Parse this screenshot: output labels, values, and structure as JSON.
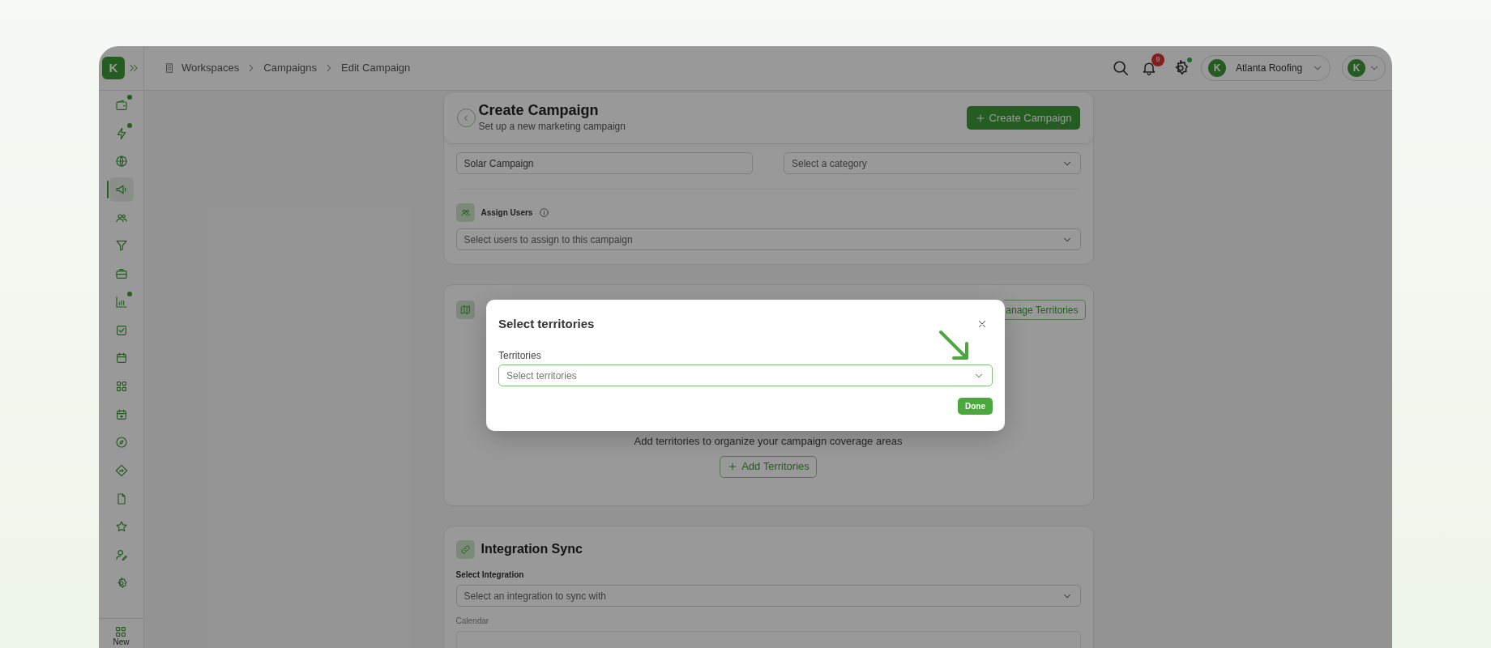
{
  "header": {
    "logo_text": "K",
    "notification_count": "9",
    "settings_dot": true,
    "organization": "Atlanta Roofing",
    "organization_logo": "K",
    "avatar": "K"
  },
  "breadcrumb": [
    {
      "label": "Workspaces"
    },
    {
      "label": "Campaigns"
    },
    {
      "label": "Edit Campaign"
    }
  ],
  "sidebar": {
    "items": [
      {
        "selected": false,
        "dot": true
      },
      {
        "selected": false,
        "dot": true
      },
      {
        "selected": false,
        "dot": false
      },
      {
        "selected": true,
        "dot": false
      },
      {
        "selected": false,
        "dot": false
      },
      {
        "selected": false,
        "dot": false
      },
      {
        "selected": false,
        "dot": false
      },
      {
        "selected": false,
        "dot": true
      },
      {
        "selected": false,
        "dot": false
      },
      {
        "selected": false,
        "dot": false
      },
      {
        "selected": false,
        "dot": false
      },
      {
        "selected": false,
        "dot": false
      },
      {
        "selected": false,
        "dot": false
      },
      {
        "selected": false,
        "dot": false
      },
      {
        "selected": false,
        "dot": false
      },
      {
        "selected": false,
        "dot": false
      },
      {
        "selected": false,
        "dot": false
      },
      {
        "selected": false,
        "dot": false
      }
    ],
    "new_label": "New"
  },
  "page": {
    "title": "Create Campaign",
    "subtitle": "Set up a new marketing campaign",
    "create_button": "Create Campaign"
  },
  "details": {
    "campaign_name_value": "Solar Campaign",
    "category_placeholder": "Select a category",
    "assign_users_label": "Assign Users",
    "users_placeholder": "Select users to assign to this campaign"
  },
  "territories": {
    "manage_button": "anage Territories",
    "empty_text": "Add territories to organize your campaign coverage areas",
    "add_button": "Add Territories"
  },
  "integration": {
    "title": "Integration Sync",
    "select_label": "Select Integration",
    "select_placeholder": "Select an integration to sync with",
    "calendar_label": "Calendar"
  },
  "modal": {
    "title": "Select territories",
    "field_label": "Territories",
    "field_placeholder": "Select territories",
    "done_button": "Done"
  }
}
